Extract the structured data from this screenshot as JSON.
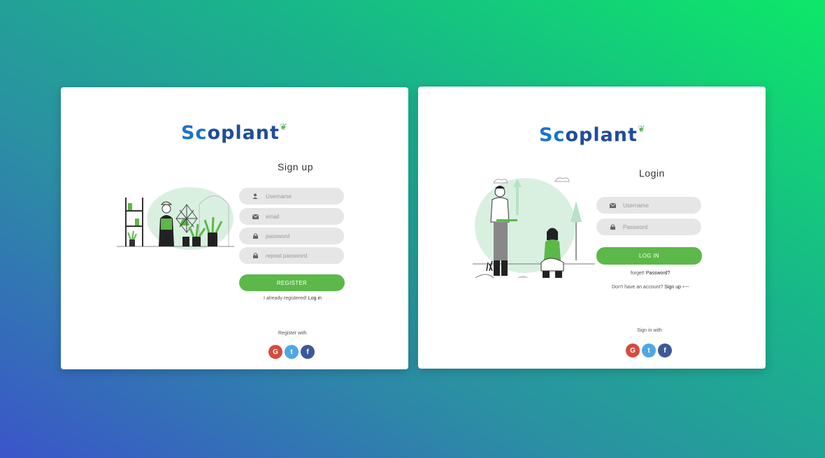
{
  "signup": {
    "logo": {
      "part1": "Sc",
      "part2": "oplant"
    },
    "title": "Sign up",
    "fields": {
      "username": {
        "placeholder": "Username",
        "icon": "user-icon"
      },
      "email": {
        "placeholder": "email",
        "icon": "envelope-icon"
      },
      "password": {
        "placeholder": "password",
        "icon": "lock-icon"
      },
      "repeat_password": {
        "placeholder": "repeat password",
        "icon": "lock-icon"
      }
    },
    "register_button": "REGISTER",
    "already_text": "I already registered!",
    "login_link": "Log in",
    "register_with": "Register with",
    "social": {
      "google": "G",
      "twitter": "t",
      "facebook": "f"
    }
  },
  "login": {
    "logo": {
      "part1": "Sc",
      "part2": "oplant"
    },
    "title": "Login",
    "fields": {
      "username": {
        "placeholder": "Username",
        "icon": "envelope-icon"
      },
      "password": {
        "placeholder": "Password",
        "icon": "lock-icon"
      }
    },
    "login_button": "LOG IN",
    "forgot_text": "forget!",
    "forgot_link": "Password?",
    "no_account_text": "Don't have an account?",
    "signup_link": "Sign up",
    "signup_arrow": "⟵",
    "sign_in_with": "Sign in with",
    "social": {
      "google": "G",
      "twitter": "t",
      "facebook": "f"
    }
  },
  "colors": {
    "accent_green": "#5cb848",
    "logo_blue": "#1a73c9",
    "google": "#d64b3c",
    "twitter": "#4fa7e3",
    "facebook": "#3b5998",
    "field_bg": "#e6e6e6"
  }
}
